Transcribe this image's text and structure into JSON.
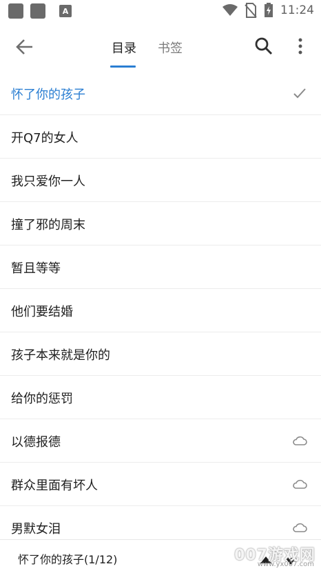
{
  "status_bar": {
    "time": "11:24",
    "badge_letter": "A"
  },
  "toolbar": {
    "tabs": [
      {
        "label": "目录"
      },
      {
        "label": "书签"
      }
    ]
  },
  "chapters": [
    {
      "title": "怀了你的孩子",
      "status": "current"
    },
    {
      "title": "开Q7的女人",
      "status": ""
    },
    {
      "title": "我只爱你一人",
      "status": ""
    },
    {
      "title": "撞了邪的周末",
      "status": ""
    },
    {
      "title": "暂且等等",
      "status": ""
    },
    {
      "title": "他们要结婚",
      "status": ""
    },
    {
      "title": "孩子本来就是你的",
      "status": ""
    },
    {
      "title": "给你的惩罚",
      "status": ""
    },
    {
      "title": "以德报德",
      "status": "cloud"
    },
    {
      "title": "群众里面有坏人",
      "status": "cloud"
    },
    {
      "title": "男默女泪",
      "status": "cloud"
    }
  ],
  "bottom_bar": {
    "current_position": "怀了你的孩子(1/12)",
    "watermark": "007游戏网",
    "watermark_url": "www.yx007.com"
  },
  "colors": {
    "accent": "#2a7ed2",
    "text": "#202020",
    "secondary": "#7a7a7a"
  }
}
